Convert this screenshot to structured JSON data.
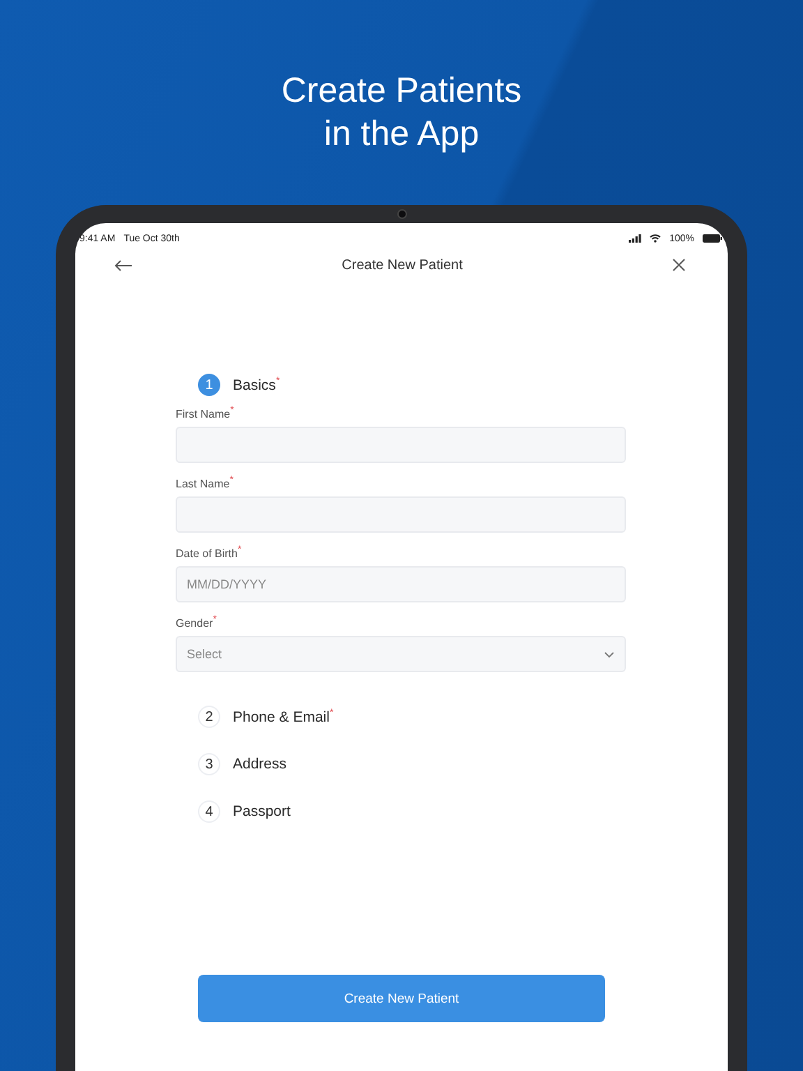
{
  "headline": [
    "Create Patients",
    "in the App"
  ],
  "status_bar": {
    "time": "9:41 AM",
    "date": "Tue Oct 30th",
    "battery": "100%"
  },
  "header": {
    "title": "Create New Patient"
  },
  "steps": [
    {
      "number": "1",
      "label": "Basics$^{*}$",
      "selected": true,
      "fields": [
        {
          "kind": "text",
          "label": "First Name$^{*}$"
        },
        {
          "kind": "text",
          "label": "Last Name$^{*}$"
        },
        {
          "kind": "text",
          "label": "Date of Birth$^{*}$",
          "placeholder": "MM/DD/YYYY"
        },
        {
          "kind": "select",
          "label": "Gender$^{*}$",
          "placeholder": "Select"
        }
      ]
    },
    {
      "number": "2",
      "label": "Phone & Email$^{*}$",
      "selected": false
    },
    {
      "number": "3",
      "label": "Address",
      "selected": false
    },
    {
      "number": "4",
      "label": "Passport",
      "selected": false
    }
  ],
  "submit_button": "Create New Patient"
}
